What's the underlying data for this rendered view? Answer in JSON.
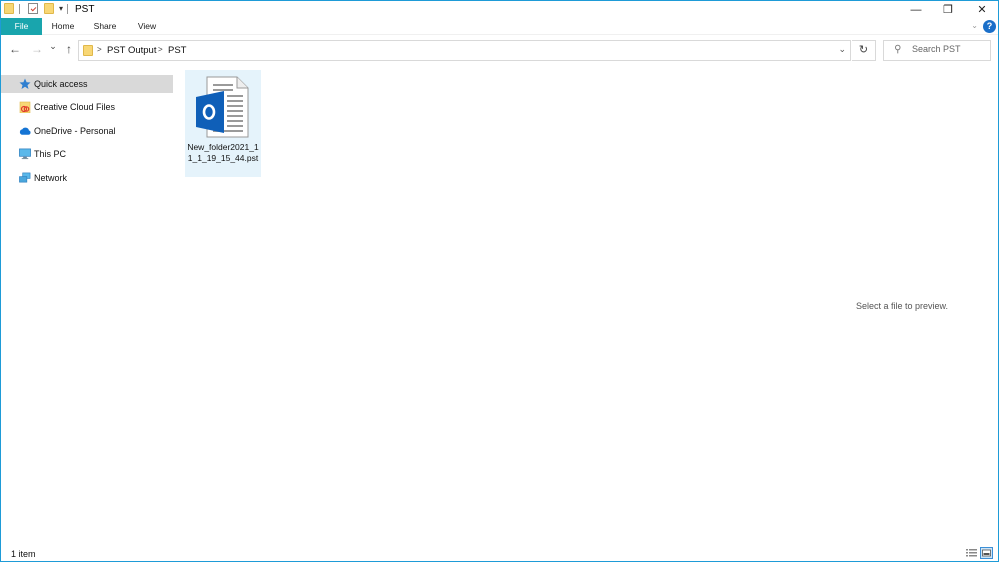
{
  "window": {
    "title": "PST",
    "controls": {
      "minimize": "—",
      "maximize": "❐",
      "close": "✕"
    }
  },
  "ribbon": {
    "tabs": [
      {
        "label": "File",
        "active": true
      },
      {
        "label": "Home"
      },
      {
        "label": "Share"
      },
      {
        "label": "View"
      }
    ],
    "expand_icon": "chevron-down",
    "help": "?"
  },
  "navigation": {
    "back": "←",
    "forward": "→",
    "recent": "⌄",
    "up": "↑",
    "breadcrumb": [
      "PST Output",
      "PST"
    ],
    "refresh": "↻",
    "search_placeholder": "Search PST"
  },
  "sidebar": {
    "items": [
      {
        "label": "Quick access",
        "icon": "star-icon",
        "selected": true
      },
      {
        "label": "Creative Cloud Files",
        "icon": "creative-cloud-icon"
      },
      {
        "label": "OneDrive - Personal",
        "icon": "cloud-icon"
      },
      {
        "label": "This PC",
        "icon": "monitor-icon"
      },
      {
        "label": "Network",
        "icon": "network-icon"
      }
    ]
  },
  "files": [
    {
      "name": "New_folder2021_11_1_19_15_44.pst",
      "type": "outlook-pst",
      "selected": true
    }
  ],
  "preview": {
    "message": "Select a file to preview."
  },
  "status": {
    "item_count": "1 item"
  },
  "colors": {
    "accent": "#19a5ad",
    "selection": "#e5f3fb",
    "window_border": "#1e9bd7",
    "outlook_blue": "#0f5fb8"
  }
}
